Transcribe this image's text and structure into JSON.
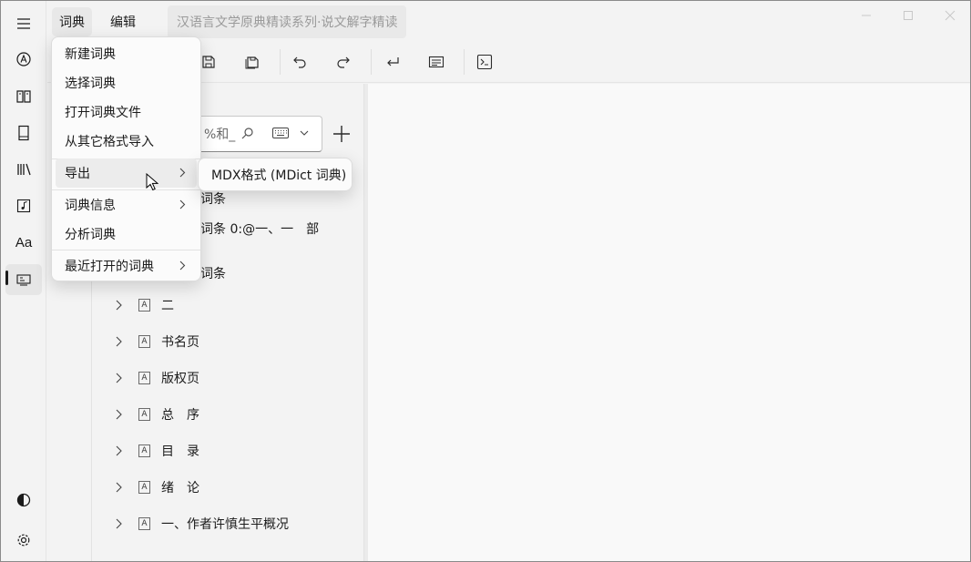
{
  "menubar": {
    "menus": [
      "词典",
      "编辑"
    ],
    "document_title": "汉语言文学原典精读系列·说文解字精读"
  },
  "rail": {
    "icons": [
      "hamburger-icon",
      "search-dictionary-icon",
      "book-icon",
      "bookmark-icon",
      "library-icon",
      "music-icon",
      "font-icon",
      "dictionary-editor-icon",
      "theme-icon",
      "settings-icon"
    ],
    "font_glyph": "Aa"
  },
  "toolbar": {
    "icons": [
      "save-icon",
      "save-all-icon",
      "undo-icon",
      "redo-icon",
      "enter-icon",
      "preview-icon",
      "terminal-icon"
    ]
  },
  "search": {
    "value": "%和_"
  },
  "dictionary_menu": {
    "items": [
      {
        "label": "新建词典"
      },
      {
        "label": "选择词典"
      },
      {
        "label": "打开词典文件"
      },
      {
        "label": "从其它格式导入"
      },
      {
        "label": "导出"
      },
      {
        "label": "词典信息"
      },
      {
        "label": "分析词典"
      },
      {
        "label": "最近打开的词典"
      }
    ]
  },
  "export_submenu": {
    "items": [
      {
        "label": "MDX格式 (MDict 词典)"
      }
    ]
  },
  "tree": {
    "partial_rows": [
      "词条",
      "词条 0:@一、一　部",
      "词条"
    ],
    "rows": [
      {
        "label": "二"
      },
      {
        "label": "书名页"
      },
      {
        "label": "版权页"
      },
      {
        "label": "总　序"
      },
      {
        "label": "目　录"
      },
      {
        "label": "绪　论"
      },
      {
        "label": "一、作者许慎生平概况"
      }
    ]
  },
  "colors": {
    "background": "#f3f3f3",
    "menu_background": "#fbfbfb",
    "text": "#1b1b1b"
  }
}
